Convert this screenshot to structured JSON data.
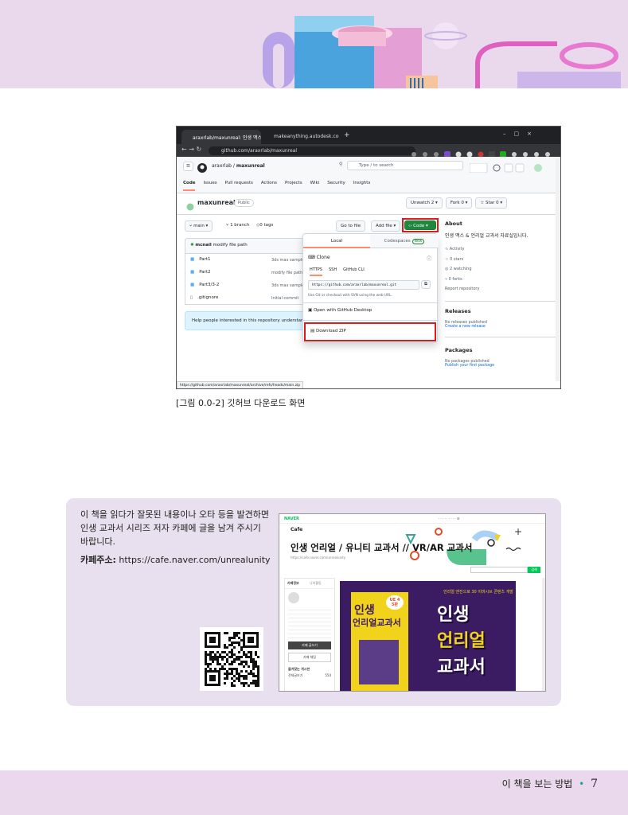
{
  "figure": {
    "browser": {
      "tab_active": "araxrlab/maxunreal: 인생 맥스 & ×",
      "tab_other": "makeanything.autodesk.com/3d ×",
      "new_tab": "+",
      "url": "github.com/araxrlab/maxunreal",
      "window_controls": [
        "–",
        "▢",
        "×"
      ]
    },
    "github": {
      "breadcrumb_owner": "araxrlab",
      "breadcrumb_sep": "/",
      "breadcrumb_repo": "maxunreal",
      "search_placeholder": "Type / to search",
      "nav_tabs": [
        "Code",
        "Issues",
        "Pull requests",
        "Actions",
        "Projects",
        "Wiki",
        "Security",
        "Insights"
      ],
      "repo_name": "maxunreal",
      "visibility": "Public",
      "unwatch": "Unwatch",
      "unwatch_count": "2",
      "fork": "Fork",
      "fork_count": "0",
      "star": "Star",
      "star_count": "0",
      "branch": "main",
      "branch_count": "1 branch",
      "tags": "0 tags",
      "goto_file": "Go to file",
      "add_file": "Add file",
      "code_button": "Code",
      "commit_author": "mcnail",
      "commit_message": "modify file path",
      "files": [
        {
          "icon": "folder",
          "name": "Part1",
          "commit": "3ds max sample"
        },
        {
          "icon": "folder",
          "name": "Part2",
          "commit": "modify file path"
        },
        {
          "icon": "folder",
          "name": "Part3/3-2",
          "commit": "3ds max sample"
        },
        {
          "icon": "file",
          "name": ".gitignore",
          "commit": "Initial commit"
        }
      ],
      "help_banner": "Help people interested in this repository understand",
      "dropdown": {
        "tab_local": "Local",
        "tab_codespaces": "Codespaces",
        "new_badge": "New",
        "clone": "Clone",
        "clone_tabs": [
          "HTTPS",
          "SSH",
          "GitHub CLI"
        ],
        "clone_url": "https://github.com/araxrlab/maxunreal.git",
        "clone_hint": "Use Git or checkout with SVN using the web URL.",
        "open_desktop": "Open with GitHub Desktop",
        "download_zip": "Download ZIP"
      },
      "about_title": "About",
      "about_desc": "인생 맥스 & 언리얼 교과서 자료실입니다.",
      "about_items": [
        "Activity",
        "0 stars",
        "2 watching",
        "0 forks",
        "Report repository"
      ],
      "releases_title": "Releases",
      "releases_text": "No releases published",
      "releases_link": "Create a new release",
      "packages_title": "Packages",
      "packages_text": "No packages published",
      "packages_link": "Publish your first package",
      "status_url": "https://github.com/araxrlab/maxunreal/archive/refs/heads/main.zip"
    }
  },
  "caption": "[그림 0.0-2] 깃허브 다운로드 화면",
  "info": {
    "body": "이 책을 읽다가 잘못된 내용이나 오타 등을 발견하면 인생 교과서 시리즈 저자 카페에 글을 남겨 주시기 바랍니다.",
    "cafe_label": "카페주소:",
    "cafe_url": "https://cafe.naver.com/unrealunity"
  },
  "cafe": {
    "naver": "NAVER",
    "cafe_word": "Cafe",
    "title": "인생 언리얼 / 유니티 교과서 // VR/AR 교과서",
    "url_small": "https://cafe.naver.com/unrealunity",
    "search_button": "검색",
    "sidebar_tabs": [
      "카페정보",
      "나의활동"
    ],
    "write_button": "카페 글쓰기",
    "chat_button": "카페 채팅",
    "board_header": "즐겨찾는 게시판",
    "board_item": "전체글보기",
    "board_count": "554",
    "book_side": "언리얼 엔진으로 30 이머시브 콘텐츠 개발",
    "book_title_1": "인생",
    "book_title_2": "언리얼",
    "book_title_3": "교과서",
    "book_badge": "UE 4",
    "book_badge_sub": "5판"
  },
  "footer": {
    "section": "이 책을 보는 방법",
    "bullet": "•",
    "page_number": "7"
  },
  "colors": {
    "banner": "#ead9ec",
    "info_bg": "#e8e0ee",
    "github_green": "#1f883d",
    "highlight_red": "#e0191b",
    "book_purple": "#3b1c63",
    "book_yellow": "#f2d31b"
  }
}
